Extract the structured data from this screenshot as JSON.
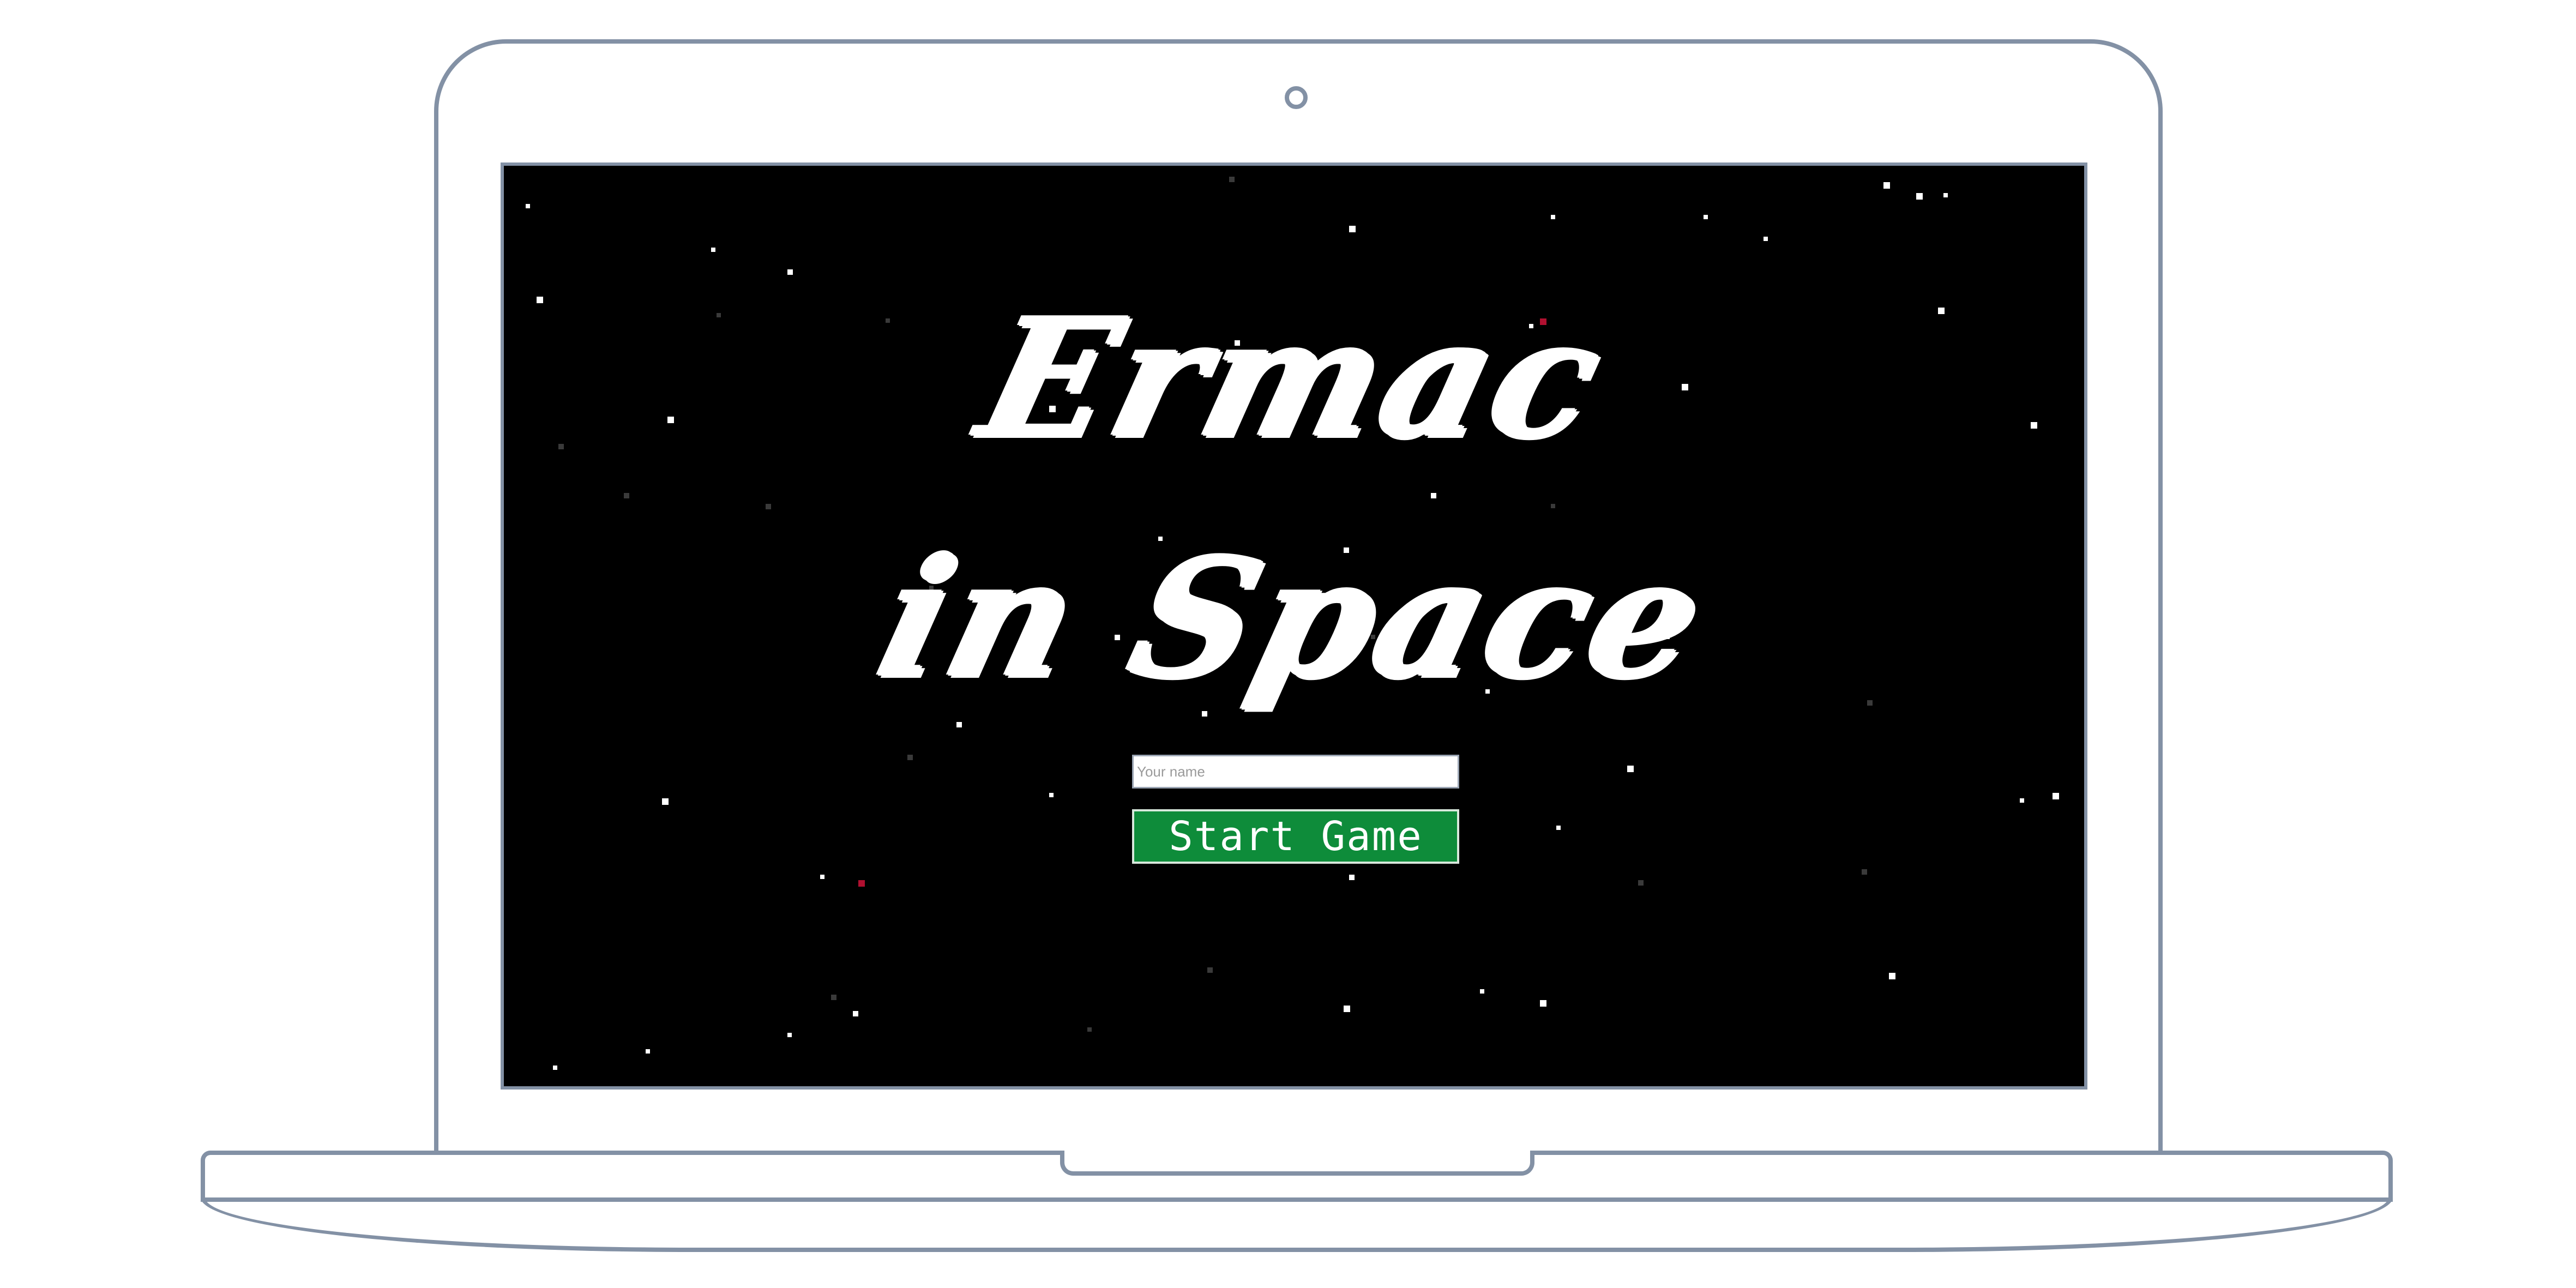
{
  "game": {
    "title_line_1": "Ermac",
    "title_line_2": "in Space",
    "name_input": {
      "placeholder": "Your name",
      "value": ""
    },
    "start_button_label": "Start Game"
  },
  "colors": {
    "background": "#000000",
    "title": "#ffffff",
    "start_button": "#0e8c3a",
    "star_white": "#ffffff",
    "star_gray": "#3a3a3a",
    "star_red": "#b01030",
    "device_outline": "#8391a5"
  },
  "icons": {
    "device": "laptop-icon",
    "camera": "camera-icon"
  }
}
